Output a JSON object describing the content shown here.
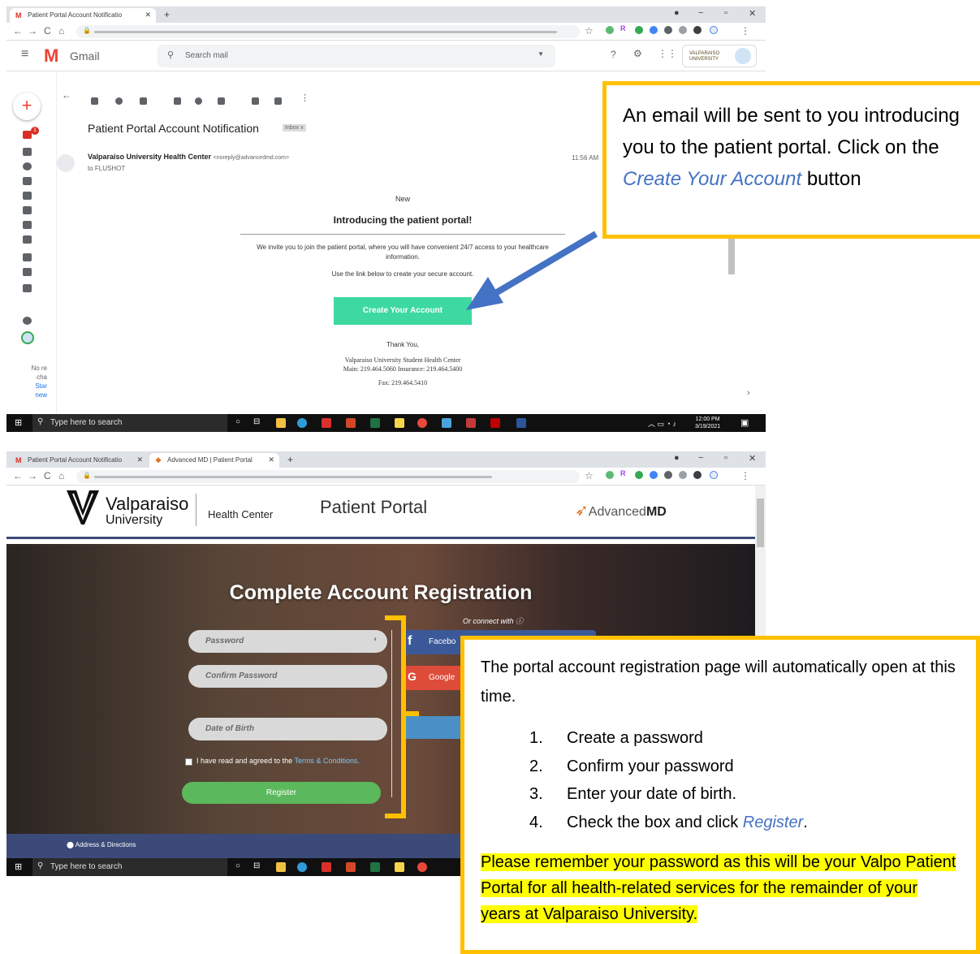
{
  "gmail_window": {
    "tab_title": "Patient Portal Account Notificatio",
    "app_name": "Gmail",
    "search_placeholder": "Search mail",
    "org_badge": "VALPARAISO UNIVERSITY",
    "email_subject": "Patient Portal Account Notification",
    "inbox_label": "Inbox x",
    "sender_name": "Valparaiso University Health Center",
    "sender_email": "<noreply@advancedmd.com>",
    "recipient": "to FLUSHOT",
    "time": "11:56 AM",
    "sidebar_snippet": [
      "No re",
      "cha",
      "Star",
      "new"
    ],
    "body": {
      "new_label": "New",
      "heading": "Introducing the patient portal!",
      "invite_text": "We invite you to join the patient portal, where you will have convenient 24/7 access to your healthcare information.",
      "link_text": "Use the link below to create your secure account.",
      "button_label": "Create Your Account",
      "thank_you": "Thank You,",
      "center_name": "Valparaiso University Student Health Center",
      "phones": "Main: 219.464.5060 Insurance: 219.464.5400",
      "fax": "Fax: 219.464.5410"
    }
  },
  "taskbar_top": {
    "search_placeholder": "Type here to search",
    "time": "12:00 PM",
    "date": "3/19/2021"
  },
  "portal_window": {
    "tabs": [
      "Patient Portal Account Notificatio",
      "Advanced MD | Patient Portal"
    ],
    "brand_name": "Valparaiso",
    "brand_sub": "University",
    "health_center": "Health Center",
    "portal_title": "Patient Portal",
    "partner_logo_light": "Advanced",
    "partner_logo_bold": "MD",
    "hero_title": "Complete Account Registration",
    "connect_label": "Or connect with",
    "social": [
      "Facebo",
      "Google"
    ],
    "fields": {
      "password": "Password",
      "confirm": "Confirm Password",
      "dob": "Date of Birth"
    },
    "terms_prefix": "I have read and agreed to the",
    "terms_link": "Terms & Conditions.",
    "register_label": "Register",
    "footer_link": "Address & Directions"
  },
  "taskbar_bottom": {
    "search_placeholder": "Type here to search"
  },
  "callout_top": {
    "text_before": "An email will be sent to you introducing you to the patient portal. Click on the",
    "button_ref": "Create Your Account",
    "text_after": "button"
  },
  "callout_bottom": {
    "intro": "The portal account registration page will automatically open at this time.",
    "steps": [
      "Create a password",
      "Confirm your password",
      "Enter your date of birth.",
      "Check the box and click"
    ],
    "step4_link": "Register",
    "step4_end": ".",
    "highlight": "Please remember your password as this will be your Valpo Patient Portal for all health-related services for the remainder of your years at Valparaiso University."
  },
  "colors": {
    "callout_border": "#ffc000",
    "create_button": "#3dd9a0",
    "register_button": "#5cb85c",
    "arrow": "#4472c4",
    "highlight": "#ffff00"
  }
}
